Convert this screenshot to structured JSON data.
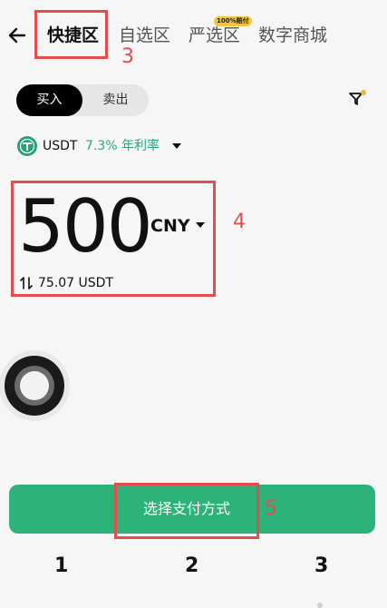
{
  "header": {
    "tabs": [
      {
        "label": "快捷区",
        "active": true
      },
      {
        "label": "自选区",
        "active": false
      },
      {
        "label": "严选区",
        "active": false,
        "badge": "100%赔付"
      },
      {
        "label": "数字商城",
        "active": false
      }
    ]
  },
  "trade": {
    "buy_label": "买入",
    "sell_label": "卖出",
    "selected": "买入"
  },
  "coin": {
    "name": "USDT",
    "rate": "7.3% 年利率"
  },
  "amount": {
    "value": "500",
    "currency": "CNY",
    "converted": "75.07 USDT"
  },
  "action": {
    "button_label": "选择支付方式"
  },
  "annotations": {
    "label_3": "3",
    "label_4": "4",
    "label_5": "5"
  },
  "bottom_numbers": [
    "1",
    "2",
    "3"
  ],
  "colors": {
    "accent_green": "#2db37a",
    "rate_green": "#2aa876",
    "annotation_red": "#e74c4c",
    "badge_yellow": "#f3c63a"
  },
  "icons": {
    "back": "arrow-left-icon",
    "filter": "filter-icon",
    "coin": "usdt-icon",
    "swap": "swap-vertical-icon"
  }
}
